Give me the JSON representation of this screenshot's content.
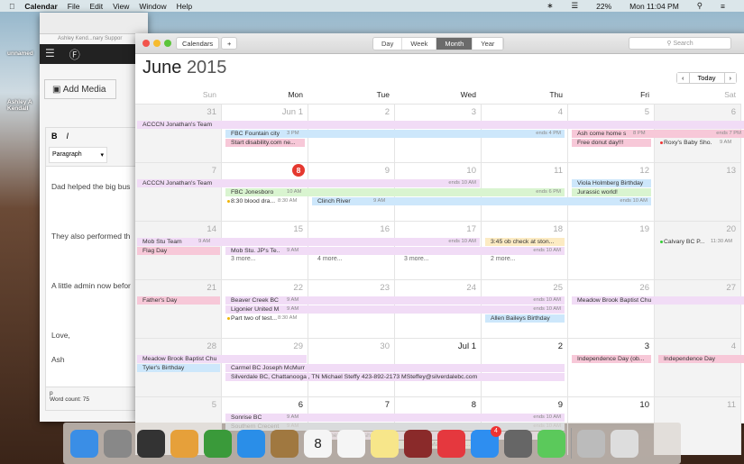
{
  "menubar": {
    "app": "Calendar",
    "items": [
      "File",
      "Edit",
      "View",
      "Window",
      "Help"
    ],
    "battery": "22%",
    "clock": "Mon 11:04 PM"
  },
  "desktop": {
    "labels": [
      "unnamed",
      "Ashley A Kendall"
    ]
  },
  "wordpress": {
    "tab": "Ashley Kend...nary Suppor",
    "add_media": "Add Media",
    "format": "Paragraph",
    "paragraphs": [
      "Dad helped the big bus",
      "They also performed th",
      "A little admin now befor",
      "Love,",
      "Ash"
    ],
    "path": "p",
    "word_count": "Word count: 75"
  },
  "calendar": {
    "calendars_button": "Calendars",
    "add_button": "+",
    "views": [
      "Day",
      "Week",
      "Month",
      "Year"
    ],
    "active_view": "Month",
    "search_placeholder": "Search",
    "month": "June",
    "year": "2015",
    "today_button": "Today",
    "weekdays": [
      "Sun",
      "Mon",
      "Tue",
      "Wed",
      "Thu",
      "Fri",
      "Sat"
    ],
    "weeks": [
      [
        {
          "n": "31"
        },
        {
          "n": "Jun 1"
        },
        {
          "n": "2"
        },
        {
          "n": "3"
        },
        {
          "n": "4"
        },
        {
          "n": "5"
        },
        {
          "n": "6"
        }
      ],
      [
        {
          "n": "7"
        },
        {
          "n": "8",
          "today": true
        },
        {
          "n": "9"
        },
        {
          "n": "10"
        },
        {
          "n": "11"
        },
        {
          "n": "12"
        },
        {
          "n": "13"
        }
      ],
      [
        {
          "n": "14"
        },
        {
          "n": "15"
        },
        {
          "n": "16"
        },
        {
          "n": "17"
        },
        {
          "n": "18"
        },
        {
          "n": "19"
        },
        {
          "n": "20"
        }
      ],
      [
        {
          "n": "21"
        },
        {
          "n": "22"
        },
        {
          "n": "23"
        },
        {
          "n": "24"
        },
        {
          "n": "25"
        },
        {
          "n": "26"
        },
        {
          "n": "27"
        }
      ],
      [
        {
          "n": "28"
        },
        {
          "n": "29"
        },
        {
          "n": "30"
        },
        {
          "n": "Jul 1",
          "dark": true
        },
        {
          "n": "2",
          "dark": true
        },
        {
          "n": "3",
          "dark": true
        },
        {
          "n": "4"
        }
      ],
      [
        {
          "n": "5"
        },
        {
          "n": "6",
          "dark": true
        },
        {
          "n": "7",
          "dark": true
        },
        {
          "n": "8",
          "dark": true
        },
        {
          "n": "9",
          "dark": true
        },
        {
          "n": "10",
          "dark": true
        },
        {
          "n": "11"
        }
      ]
    ],
    "events": [
      {
        "week": 0,
        "start": 0,
        "span": 7,
        "title": "ACCCN Jonathan's Team",
        "color": "purple"
      },
      {
        "week": 0,
        "start": 1,
        "span": 4,
        "title": "FBC Fountain city...",
        "time": "3 PM",
        "end": "ends 4 PM",
        "color": "blue"
      },
      {
        "week": 0,
        "start": 1,
        "span": 1,
        "title": "Start disability.com ne...",
        "color": "pink"
      },
      {
        "week": 0,
        "start": 5,
        "span": 2,
        "title": "Ash come home s...",
        "time": "8 PM",
        "end": "ends 7 PM",
        "color": "pink"
      },
      {
        "week": 0,
        "start": 5,
        "span": 1,
        "title": "Free donut day!!!",
        "color": "pink"
      },
      {
        "week": 0,
        "start": 6,
        "span": 1,
        "title": "Roxy's Baby Sho...",
        "time": "9 AM",
        "dot": "#e33"
      },
      {
        "week": 1,
        "start": 0,
        "span": 4,
        "title": "ACCCN Jonathan's Team",
        "end": "ends 10 AM",
        "color": "purple"
      },
      {
        "week": 1,
        "start": 1,
        "span": 4,
        "title": "FBC Jonesboro",
        "time": "10 AM",
        "end": "ends 6 PM",
        "color": "green"
      },
      {
        "week": 1,
        "start": 1,
        "span": 1,
        "title": "8:30 blood dra...",
        "time": "8:30 AM",
        "dot": "#f0b400"
      },
      {
        "week": 1,
        "start": 2,
        "span": 4,
        "title": "Clinch River",
        "time": "9 AM",
        "end": "ends 10 AM",
        "color": "blue"
      },
      {
        "week": 1,
        "start": 5,
        "span": 1,
        "title": "Viola Holmberg Birthday",
        "color": "blue"
      },
      {
        "week": 1,
        "start": 5,
        "span": 1,
        "title": "Jurassic world!",
        "color": "green"
      },
      {
        "week": 2,
        "start": 0,
        "span": 4,
        "title": "Mob Stu Team",
        "time": "9 AM",
        "end": "ends 10 AM",
        "color": "purple"
      },
      {
        "week": 2,
        "start": 0,
        "span": 1,
        "title": "Flag Day",
        "color": "pink"
      },
      {
        "week": 2,
        "start": 1,
        "span": 4,
        "title": "Mob Stu. JP's Te...",
        "time": "9 AM",
        "end": "ends 10 AM",
        "color": "purple"
      },
      {
        "week": 2,
        "start": 4,
        "span": 1,
        "title": "3:45 ob check at ston...",
        "color": "yellow"
      },
      {
        "week": 2,
        "start": 6,
        "span": 1,
        "title": "Calvary BC P...",
        "time": "11:30 AM",
        "dot": "#3c3"
      },
      {
        "week": 3,
        "start": 0,
        "span": 1,
        "title": "Father's Day",
        "color": "pink"
      },
      {
        "week": 3,
        "start": 1,
        "span": 4,
        "title": "Beaver Creek BC",
        "time": "9 AM",
        "end": "ends 10 AM",
        "color": "purple"
      },
      {
        "week": 3,
        "start": 1,
        "span": 4,
        "title": "Ligonier United M...",
        "time": "9 AM",
        "end": "ends 10 AM",
        "color": "purple"
      },
      {
        "week": 3,
        "start": 1,
        "span": 1,
        "title": "Part two of test...",
        "time": "8:30 AM",
        "dot": "#f0b400"
      },
      {
        "week": 3,
        "start": 4,
        "span": 1,
        "title": "Allen Baileys Birthday",
        "color": "blue"
      },
      {
        "week": 3,
        "start": 5,
        "span": 2,
        "title": "Meadow Brook Baptist Church, AL 3.24-26 Ben Bir...",
        "color": "purple"
      },
      {
        "week": 4,
        "start": 0,
        "span": 2,
        "title": "Meadow Brook Baptist Church, AL 3.24-26 Ben Bir...",
        "color": "purple"
      },
      {
        "week": 4,
        "start": 0,
        "span": 1,
        "title": "Tyler's Birthday",
        "color": "blue"
      },
      {
        "week": 4,
        "start": 1,
        "span": 4,
        "title": "Carmel BC Joseph McMurry",
        "color": "purple"
      },
      {
        "week": 4,
        "start": 1,
        "span": 4,
        "title": "Silverdale BC, Chattanooga , TN   Michael Steffy 423-892-2173     MSteffey@silverdalebc.com",
        "color": "purple"
      },
      {
        "week": 4,
        "start": 5,
        "span": 1,
        "title": "Independence Day (ob...",
        "color": "pink"
      },
      {
        "week": 4,
        "start": 6,
        "span": 1,
        "title": "Independence Day",
        "color": "pink"
      },
      {
        "week": 5,
        "start": 1,
        "span": 4,
        "title": "Sonrise BC",
        "time": "9 AM",
        "end": "ends 10 AM",
        "color": "purple"
      },
      {
        "week": 5,
        "start": 1,
        "span": 4,
        "title": "Southern Crecent...",
        "time": "9 AM",
        "end": "ends 10 AM",
        "color": "blue"
      },
      {
        "week": 5,
        "start": 2,
        "span": 3,
        "title": "Perimeter Goldrush",
        "color": "purple"
      },
      {
        "week": 5,
        "start": 3,
        "span": 1,
        "title": "Send out Mail Chip Ne...",
        "color": "green"
      }
    ],
    "more": [
      {
        "week": 2,
        "day": 1,
        "text": "3 more..."
      },
      {
        "week": 2,
        "day": 2,
        "text": "4 more..."
      },
      {
        "week": 2,
        "day": 3,
        "text": "3 more..."
      },
      {
        "week": 2,
        "day": 4,
        "text": "2 more..."
      }
    ],
    "colors": {
      "purple": "#f1dcf6",
      "blue": "#cde7fb",
      "pink": "#f7c8d8",
      "green": "#d9f4d0",
      "yellow": "#fcebc3"
    }
  },
  "dock": [
    {
      "name": "finder",
      "color": "#3a8ee6"
    },
    {
      "name": "launchpad",
      "color": "#888"
    },
    {
      "name": "mission-control",
      "color": "#333"
    },
    {
      "name": "pages",
      "color": "#e6a03a"
    },
    {
      "name": "app-green",
      "color": "#3a9a3a"
    },
    {
      "name": "safari",
      "color": "#2a8ee8"
    },
    {
      "name": "contacts",
      "color": "#a07840"
    },
    {
      "name": "calendar",
      "color": "#f5f5f5",
      "label": "8"
    },
    {
      "name": "reminders",
      "color": "#f5f5f5"
    },
    {
      "name": "notes",
      "color": "#f7e68a"
    },
    {
      "name": "photo-booth",
      "color": "#8a2a2a"
    },
    {
      "name": "itunes",
      "color": "#e5383e"
    },
    {
      "name": "app-store",
      "color": "#2e8ef0",
      "badge": "4"
    },
    {
      "name": "system-preferences",
      "color": "#666"
    },
    {
      "name": "facetime",
      "color": "#5bc95b"
    },
    {
      "name": "preview",
      "color": "#bbb"
    },
    {
      "name": "trash",
      "color": "#ddd"
    }
  ]
}
